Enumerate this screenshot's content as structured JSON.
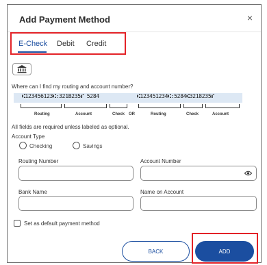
{
  "dialog": {
    "title": "Add Payment Method",
    "close_glyph": "×"
  },
  "tabs": [
    {
      "label": "E-Check",
      "active": true
    },
    {
      "label": "Debit",
      "active": false
    },
    {
      "label": "Credit",
      "active": false
    }
  ],
  "bank_icon": "bank-icon",
  "help_text": "Where can I find my routing and account number?",
  "check_image": {
    "micr_left": "⑆123456123⑆:321B235⑈ 5284",
    "micr_right": "⑆123451234⑆:5284⑆3218235⑈",
    "or_label": "OR",
    "labels_left": [
      "Routing",
      "Account",
      "Check"
    ],
    "labels_right": [
      "Routing",
      "Check",
      "Account"
    ]
  },
  "required_note": "All fields are required unless labeled as optional.",
  "account_type": {
    "label": "Account Type",
    "options": [
      "Checking",
      "Savings"
    ]
  },
  "fields": {
    "routing_number": {
      "label": "Routing Number",
      "value": ""
    },
    "account_number": {
      "label": "Account Number",
      "value": ""
    },
    "bank_name": {
      "label": "Bank Name",
      "value": ""
    },
    "name_on_account": {
      "label": "Name on Account",
      "value": ""
    }
  },
  "default_checkbox": {
    "label": "Set as default payment method",
    "checked": false
  },
  "buttons": {
    "back": "BACK",
    "add": "ADD"
  },
  "colors": {
    "accent": "#1b4ea0",
    "highlight": "#e32227"
  }
}
